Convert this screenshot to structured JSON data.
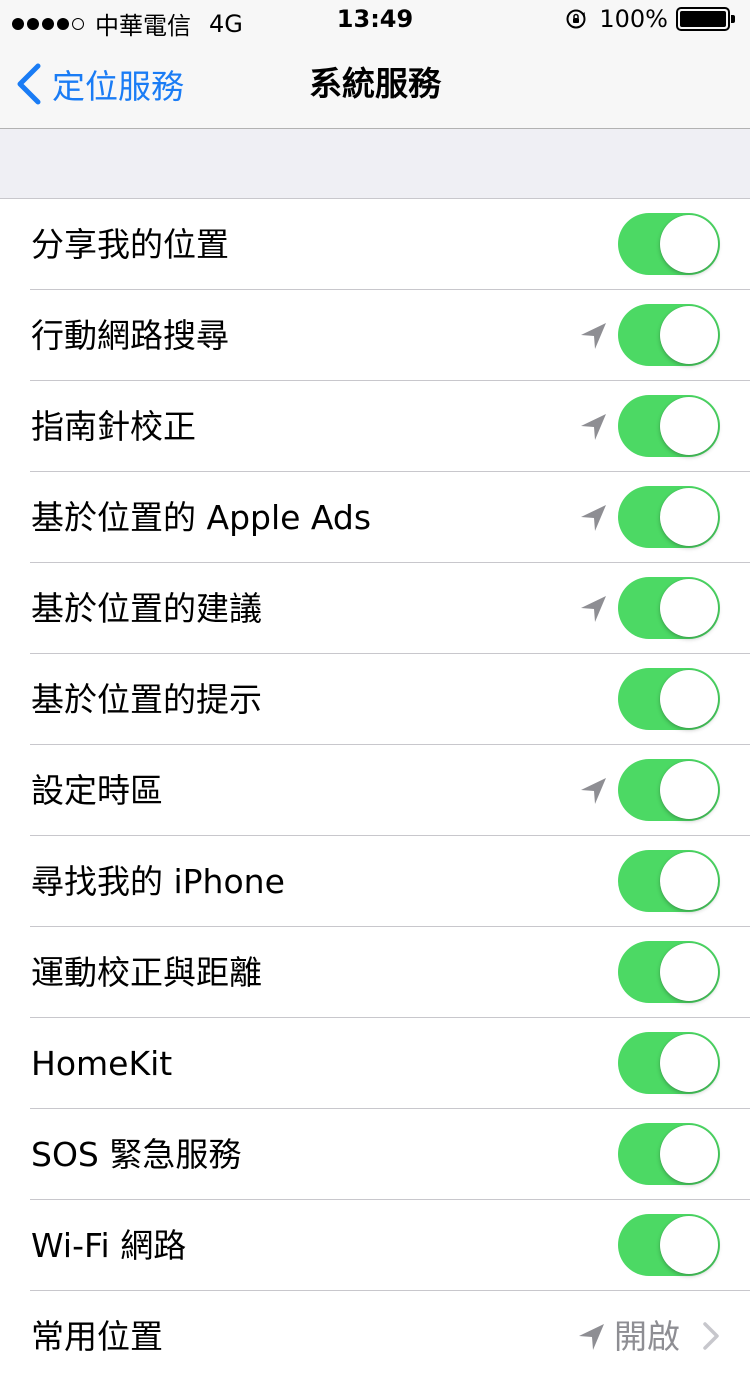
{
  "status_bar": {
    "carrier": "中華電信",
    "network": "4G",
    "time": "13:49",
    "battery": "100%"
  },
  "nav": {
    "back_label": "定位服務",
    "title": "系統服務"
  },
  "rows": [
    {
      "label": "分享我的位置",
      "on": true,
      "arrow": false
    },
    {
      "label": "行動網路搜尋",
      "on": true,
      "arrow": true
    },
    {
      "label": "指南針校正",
      "on": true,
      "arrow": true
    },
    {
      "label": "基於位置的 Apple Ads",
      "on": true,
      "arrow": true
    },
    {
      "label": "基於位置的建議",
      "on": true,
      "arrow": true
    },
    {
      "label": "基於位置的提示",
      "on": true,
      "arrow": false
    },
    {
      "label": "設定時區",
      "on": true,
      "arrow": true
    },
    {
      "label": "尋找我的 iPhone",
      "on": true,
      "arrow": false
    },
    {
      "label": "運動校正與距離",
      "on": true,
      "arrow": false
    },
    {
      "label": "HomeKit",
      "on": true,
      "arrow": false
    },
    {
      "label": "SOS 緊急服務",
      "on": true,
      "arrow": false
    },
    {
      "label": "Wi-Fi 網路",
      "on": true,
      "arrow": false
    }
  ],
  "frequent_locations": {
    "label": "常用位置",
    "value": "開啟"
  },
  "colors": {
    "toggle_on": "#4cd964",
    "accent": "#1a7cf5",
    "arrow_gray": "#8e8e93"
  }
}
